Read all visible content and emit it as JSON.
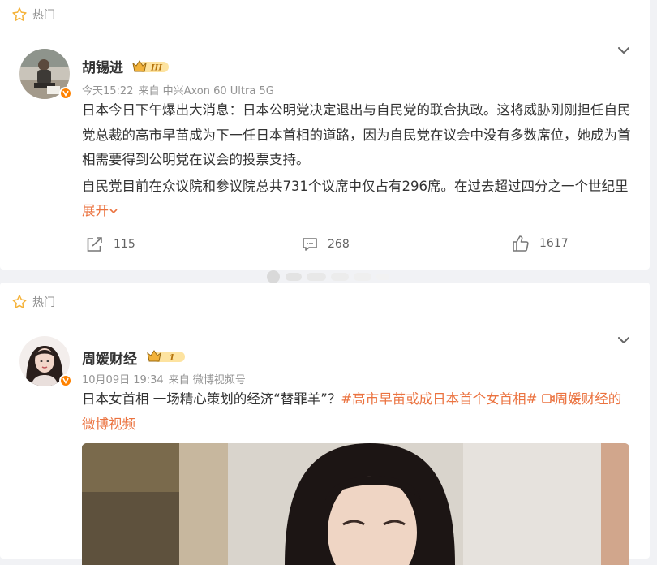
{
  "post1": {
    "hot_label": "热门",
    "author": "胡锡进",
    "level_badge": "III",
    "time": "今天15:22",
    "source": "来自 中兴Axon 60 Ultra 5G",
    "paragraph1": "日本今日下午爆出大消息：日本公明党决定退出与自民党的联合执政。这将威胁刚刚担任自民党总裁的高市早苗成为下一任日本首相的道路，因为自民党在议会中没有多数席位，她成为首相需要得到公明党在议会的投票支持。",
    "paragraph2": "自民党目前在众议院和参议院总共731个议席中仅占有296席。在过去超过四分之一个世纪里",
    "expand_label": "展开",
    "reposts": "115",
    "comments": "268",
    "likes": "1617"
  },
  "post2": {
    "hot_label": "热门",
    "author": "周媛财经",
    "level_badge": "1",
    "time": "10月09日 19:34",
    "source": "来自 微博视频号",
    "text_main": "日本女首相 一场精心策划的经济“替罪羊”？",
    "topic": "#高市早苗或成日本首个女首相#",
    "video_link": "周媛财经的微博视频"
  },
  "colors": {
    "accent": "#eb7340",
    "verified": "#ff8200",
    "star": "#f5b33b",
    "background": "#f1f2f5"
  },
  "icons": [
    "star-icon",
    "chevron-down-icon",
    "repost-icon",
    "comment-icon",
    "like-icon",
    "crown-icon",
    "verified-icon",
    "video-icon"
  ]
}
